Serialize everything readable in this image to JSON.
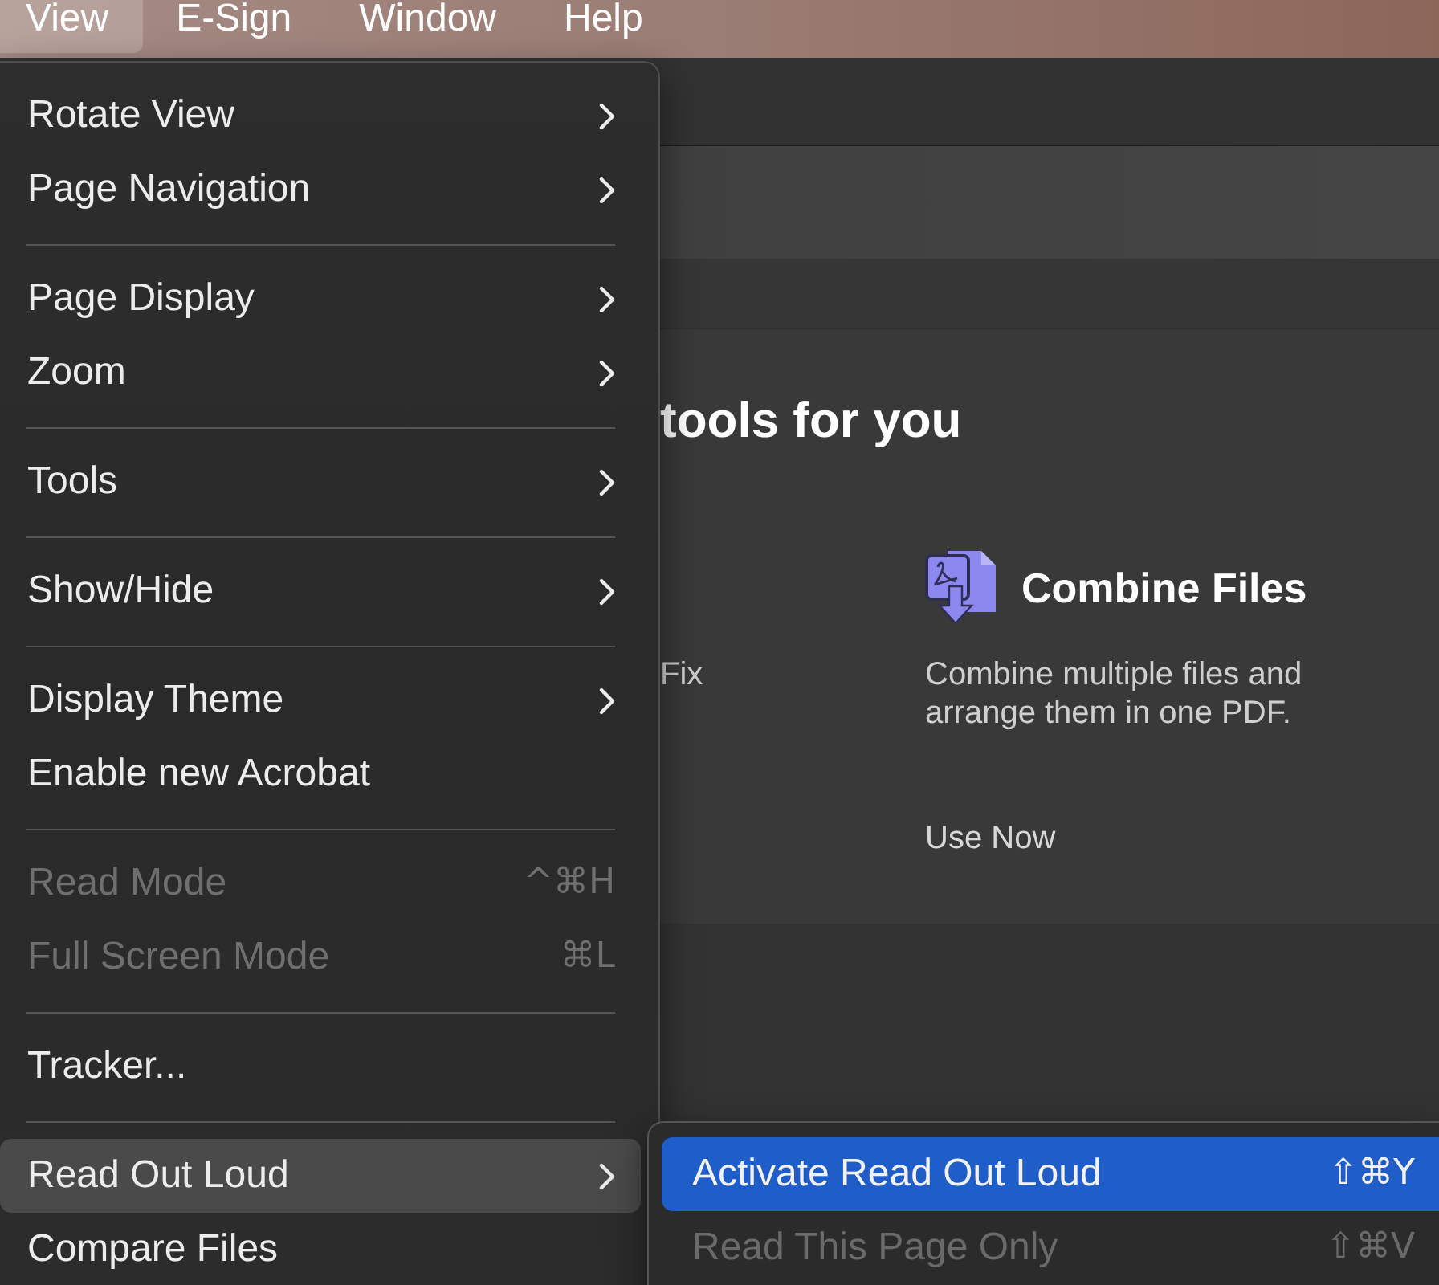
{
  "menu_bar": {
    "items": [
      {
        "label": "View",
        "selected": true
      },
      {
        "label": "E-Sign",
        "selected": false
      },
      {
        "label": "Window",
        "selected": false
      },
      {
        "label": "Help",
        "selected": false
      }
    ]
  },
  "background": {
    "heading": "tools for you",
    "cards": [
      {
        "kind": "partial",
        "description": "Fix"
      },
      {
        "kind": "tool",
        "title": "Combine Files",
        "description": "Combine multiple files and arrange them in one PDF.",
        "action": "Use Now"
      }
    ]
  },
  "view_menu": {
    "items": [
      {
        "kind": "item",
        "label": "Rotate View",
        "has_submenu": true,
        "disabled": false,
        "selected": false
      },
      {
        "kind": "item",
        "label": "Page Navigation",
        "has_submenu": true,
        "disabled": false,
        "selected": false
      },
      {
        "kind": "separator"
      },
      {
        "kind": "item",
        "label": "Page Display",
        "has_submenu": true,
        "disabled": false,
        "selected": false
      },
      {
        "kind": "item",
        "label": "Zoom",
        "has_submenu": true,
        "disabled": false,
        "selected": false
      },
      {
        "kind": "separator"
      },
      {
        "kind": "item",
        "label": "Tools",
        "has_submenu": true,
        "disabled": false,
        "selected": false
      },
      {
        "kind": "separator"
      },
      {
        "kind": "item",
        "label": "Show/Hide",
        "has_submenu": true,
        "disabled": false,
        "selected": false
      },
      {
        "kind": "separator"
      },
      {
        "kind": "item",
        "label": "Display Theme",
        "has_submenu": true,
        "disabled": false,
        "selected": false
      },
      {
        "kind": "item",
        "label": "Enable new Acrobat",
        "has_submenu": false,
        "disabled": false,
        "selected": false
      },
      {
        "kind": "separator"
      },
      {
        "kind": "item",
        "label": "Read Mode",
        "shortcut": "^⌘H",
        "has_submenu": false,
        "disabled": true,
        "selected": false
      },
      {
        "kind": "item",
        "label": "Full Screen Mode",
        "shortcut": "⌘L",
        "has_submenu": false,
        "disabled": true,
        "selected": false
      },
      {
        "kind": "separator"
      },
      {
        "kind": "item",
        "label": "Tracker...",
        "has_submenu": false,
        "disabled": false,
        "selected": false
      },
      {
        "kind": "separator"
      },
      {
        "kind": "item",
        "label": "Read Out Loud",
        "has_submenu": true,
        "disabled": false,
        "selected": true
      },
      {
        "kind": "item",
        "label": "Compare Files",
        "has_submenu": false,
        "disabled": false,
        "selected": false
      }
    ]
  },
  "submenu": {
    "items": [
      {
        "label": "Activate Read Out Loud",
        "shortcut": "⇧⌘Y",
        "selected": true,
        "disabled": false
      },
      {
        "label": "Read This Page Only",
        "shortcut": "⇧⌘V",
        "selected": false,
        "disabled": true
      }
    ]
  }
}
